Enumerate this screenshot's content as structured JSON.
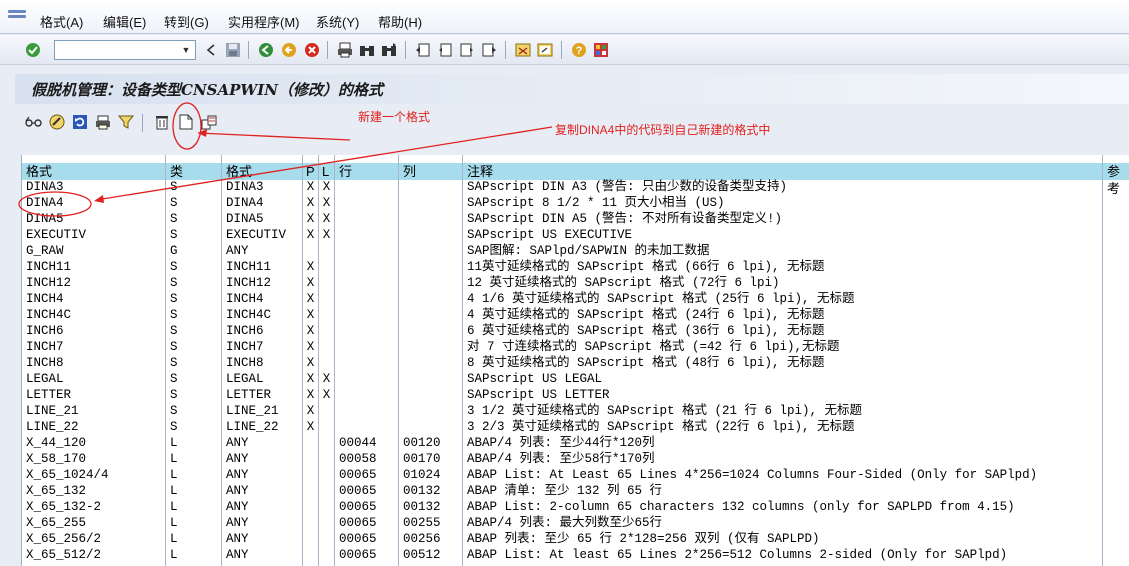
{
  "menu": [
    "格式(A)",
    "编辑(E)",
    "转到(G)",
    "实用程序(M)",
    "系统(Y)",
    "帮助(H)"
  ],
  "toolbar": {
    "command_value": "",
    "icons": [
      "enter-icon",
      "back-icon",
      "save-icon",
      "back-nav-icon",
      "exit-icon",
      "cancel-icon",
      "print-icon",
      "find-icon",
      "find-next-icon",
      "first-page-icon",
      "prev-page-icon",
      "next-page-icon",
      "last-page-icon",
      "new-session-icon",
      "shortcut-icon",
      "help-icon",
      "layout-menu-icon"
    ]
  },
  "title": "假脱机管理：设备类型CNSAPWIN（修改）的格式",
  "app_toolbar": {
    "icons": [
      "glasses-icon",
      "change-icon",
      "refresh-icon",
      "print-format-icon",
      "filter-icon",
      "delete-icon",
      "create-icon",
      "copy-icon"
    ]
  },
  "annotations": {
    "new_format": "新建一个格式",
    "copy_note": "复制DINA4中的代码到自己新建的格式中"
  },
  "table": {
    "columns": [
      "格式",
      "类",
      "格式",
      "P",
      "L",
      "行",
      "列",
      "注释",
      "参考"
    ],
    "rows": [
      [
        "DINA3",
        "S",
        "DINA3",
        "X",
        "X",
        "",
        "",
        "SAPscript DIN A3 (警告: 只由少数的设备类型支持)"
      ],
      [
        "DINA4",
        "S",
        "DINA4",
        "X",
        "X",
        "",
        "",
        "SAPscript 8 1/2 * 11 页大小相当 (US)"
      ],
      [
        "DINA5",
        "S",
        "DINA5",
        "X",
        "X",
        "",
        "",
        "SAPscript DIN A5 (警告: 不对所有设备类型定义!)"
      ],
      [
        "EXECUTIV",
        "S",
        "EXECUTIV",
        "X",
        "X",
        "",
        "",
        "SAPscript US EXECUTIVE"
      ],
      [
        "G_RAW",
        "G",
        "ANY",
        "",
        "",
        "",
        "",
        "SAP图解: SAPlpd/SAPWIN 的未加工数据"
      ],
      [
        "INCH11",
        "S",
        "INCH11",
        "X",
        "",
        "",
        "",
        "11英寸延续格式的 SAPscript 格式 (66行 6 lpi), 无标题"
      ],
      [
        "INCH12",
        "S",
        "INCH12",
        "X",
        "",
        "",
        "",
        "12 英寸延续格式的 SAPscript 格式 (72行 6 lpi)"
      ],
      [
        "INCH4",
        "S",
        "INCH4",
        "X",
        "",
        "",
        "",
        "4 1/6 英寸延续格式的 SAPscript 格式 (25行 6 lpi), 无标题"
      ],
      [
        "INCH4C",
        "S",
        "INCH4C",
        "X",
        "",
        "",
        "",
        "4 英寸延续格式的 SAPscript 格式 (24行 6 lpi), 无标题"
      ],
      [
        "INCH6",
        "S",
        "INCH6",
        "X",
        "",
        "",
        "",
        "6 英寸延续格式的 SAPscript 格式 (36行 6 lpi), 无标题"
      ],
      [
        "INCH7",
        "S",
        "INCH7",
        "X",
        "",
        "",
        "",
        "对 7 寸连续格式的 SAPscript 格式 (=42 行 6 lpi),无标题"
      ],
      [
        "INCH8",
        "S",
        "INCH8",
        "X",
        "",
        "",
        "",
        "8 英寸延续格式的 SAPscript 格式 (48行 6 lpi), 无标题"
      ],
      [
        "LEGAL",
        "S",
        "LEGAL",
        "X",
        "X",
        "",
        "",
        "SAPscript US LEGAL"
      ],
      [
        "LETTER",
        "S",
        "LETTER",
        "X",
        "X",
        "",
        "",
        "SAPscript US LETTER"
      ],
      [
        "LINE_21",
        "S",
        "LINE_21",
        "X",
        "",
        "",
        "",
        "3 1/2 英寸延续格式的 SAPscript 格式 (21 行 6 lpi), 无标题"
      ],
      [
        "LINE_22",
        "S",
        "LINE_22",
        "X",
        "",
        "",
        "",
        "3 2/3 英寸延续格式的 SAPscript 格式 (22行 6 lpi), 无标题"
      ],
      [
        "X_44_120",
        "L",
        "ANY",
        "",
        "",
        "00044",
        "00120",
        "ABAP/4 列表: 至少44行*120列"
      ],
      [
        "X_58_170",
        "L",
        "ANY",
        "",
        "",
        "00058",
        "00170",
        "ABAP/4 列表: 至少58行*170列"
      ],
      [
        "X_65_1024/4",
        "L",
        "ANY",
        "",
        "",
        "00065",
        "01024",
        "ABAP List: At Least 65 Lines 4*256=1024 Columns Four-Sided (Only for SAPlpd)"
      ],
      [
        "X_65_132",
        "L",
        "ANY",
        "",
        "",
        "00065",
        "00132",
        "ABAP 清单: 至少 132 列 65 行"
      ],
      [
        "X_65_132-2",
        "L",
        "ANY",
        "",
        "",
        "00065",
        "00132",
        "ABAP List: 2-column 65 characters 132 columns (only for SAPLPD from 4.15)"
      ],
      [
        "X_65_255",
        "L",
        "ANY",
        "",
        "",
        "00065",
        "00255",
        "ABAP/4 列表: 最大列数至少65行"
      ],
      [
        "X_65_256/2",
        "L",
        "ANY",
        "",
        "",
        "00065",
        "00256",
        "ABAP 列表: 至少 65 行 2*128=256 双列 (仅有 SAPLPD)"
      ],
      [
        "X_65_512/2",
        "L",
        "ANY",
        "",
        "",
        "00065",
        "00512",
        "ABAP List:  At least 65 Lines 2*256=512 Columns 2-sided (Only for SAPlpd)"
      ]
    ]
  }
}
